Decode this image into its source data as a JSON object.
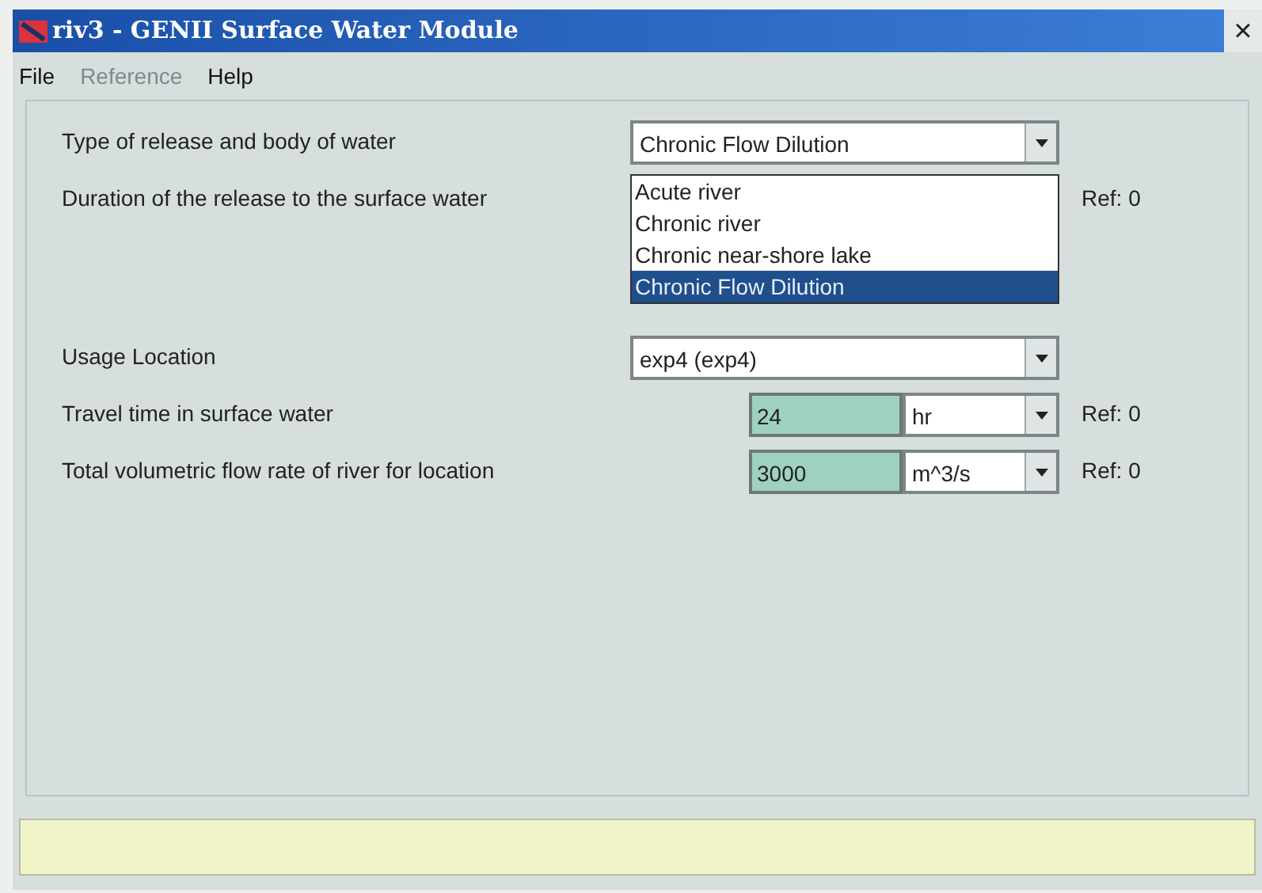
{
  "window": {
    "title": "riv3 - GENII Surface Water Module",
    "close": "×"
  },
  "menu": [
    {
      "label": "File",
      "disabled": false
    },
    {
      "label": "Reference",
      "disabled": true
    },
    {
      "label": "Help",
      "disabled": false
    }
  ],
  "rows": [
    {
      "kind": "combo",
      "label": "Type of release and body of water",
      "value": "Chronic Flow Dilution",
      "open_list": [
        {
          "label": "Acute river",
          "selected": false
        },
        {
          "label": "Chronic river",
          "selected": false
        },
        {
          "label": "Chronic near-shore lake",
          "selected": false
        },
        {
          "label": "Chronic Flow Dilution",
          "selected": true
        }
      ]
    },
    {
      "kind": "covered",
      "label": "Duration of the release to the surface water",
      "ref": "Ref: 0"
    },
    {
      "kind": "combo",
      "label": "Usage Location",
      "value": "exp4 (exp4)"
    },
    {
      "kind": "measure",
      "label": "Travel time in surface water",
      "value": "24",
      "unit": "hr",
      "ref": "Ref: 0"
    },
    {
      "kind": "measure",
      "label": "Total volumetric flow rate of river for location",
      "value": "3000",
      "unit": "m^3/s",
      "ref": "Ref: 0"
    }
  ]
}
